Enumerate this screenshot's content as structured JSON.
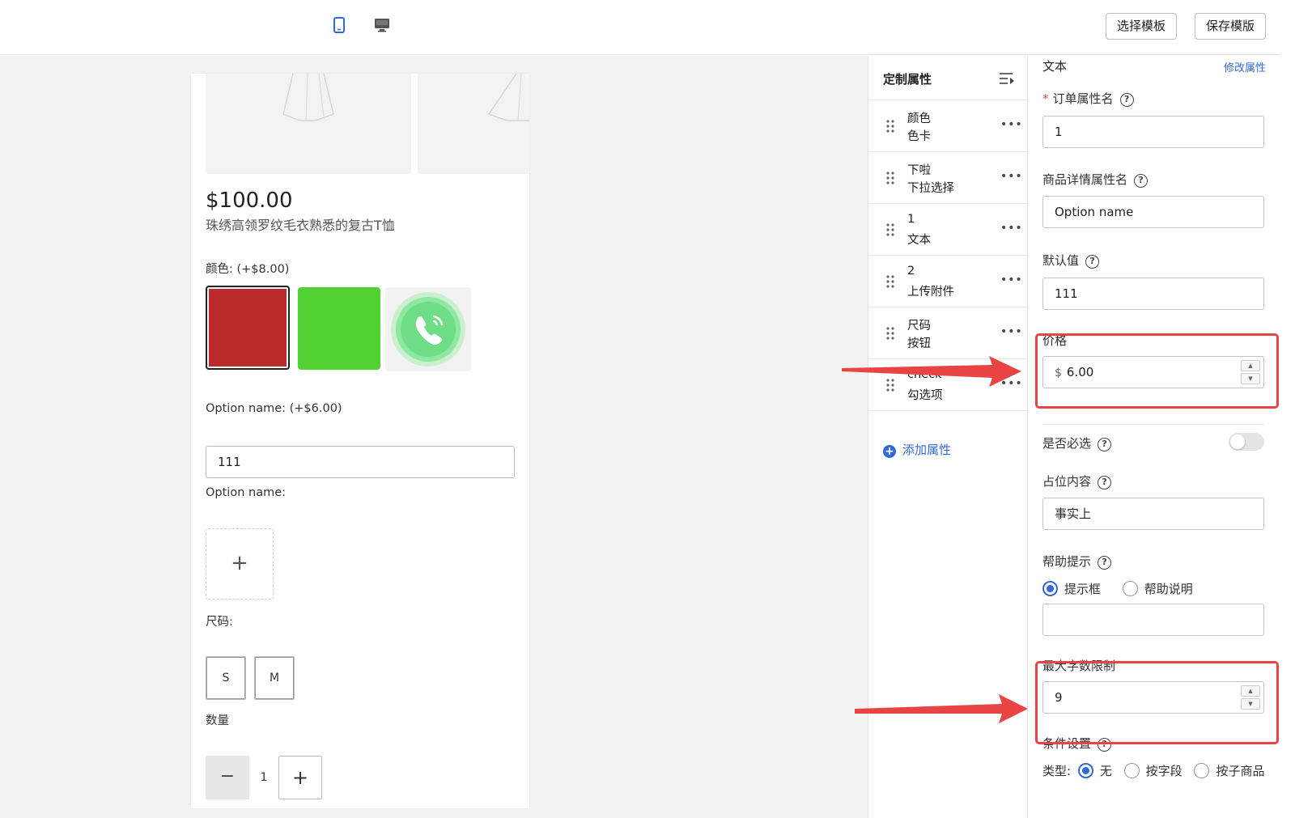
{
  "toolbar": {
    "device_icons": [
      "mobile-icon",
      "desktop-icon"
    ],
    "select_template": "选择模板",
    "save_template": "保存模版"
  },
  "preview": {
    "price": "$100.00",
    "product_name": "珠绣高领罗纹毛衣熟悉的复古T恤",
    "color_label": "颜色: (+$8.00)",
    "swatches": [
      "#bc2b2b",
      "#52d232",
      "phone-icon"
    ],
    "option_text_label": "Option name:  (+$6.00)",
    "option_text_value": "111",
    "option_upload_label": "Option name:",
    "upload_plus": "+",
    "size_label": "尺码:",
    "sizes": [
      "S",
      "M"
    ],
    "quantity_label": "数量",
    "quantity_minus": "−",
    "quantity_value": "1",
    "quantity_plus": "+"
  },
  "attr_list": {
    "title": "定制属性",
    "items": [
      {
        "name": "颜色",
        "type": "色卡"
      },
      {
        "name": "下啦",
        "type": "下拉选择"
      },
      {
        "name": "1",
        "type": "文本"
      },
      {
        "name": "2",
        "type": "上传附件"
      },
      {
        "name": "尺码",
        "type": "按钮"
      },
      {
        "name": "check",
        "type": "勾选项"
      }
    ],
    "more": "•••",
    "add_label": "添加属性"
  },
  "props": {
    "title": "文本",
    "edit_link": "修改属性",
    "order_attr_label": "订单属性名",
    "order_attr_value": "1",
    "detail_attr_label": "商品详情属性名",
    "detail_attr_value": "Option name",
    "default_label": "默认值",
    "default_value": "111",
    "price_label": "价格",
    "price_prefix": "$",
    "price_value": "6.00",
    "required_label": "是否必选",
    "required_on": false,
    "placeholder_label": "占位内容",
    "placeholder_value": "事实上",
    "help_label": "帮助提示",
    "help_options": [
      "提示框",
      "帮助说明"
    ],
    "help_selected": 0,
    "help_value": "",
    "maxlen_label": "最大字数限制",
    "maxlen_value": "9",
    "condition_label": "条件设置",
    "type_label": "类型:",
    "type_options": [
      "无",
      "按字段",
      "按子商品"
    ],
    "type_selected": 0,
    "help_mark": "?"
  },
  "colors": {
    "accent": "#3368d9",
    "annotation": "#e84444"
  }
}
